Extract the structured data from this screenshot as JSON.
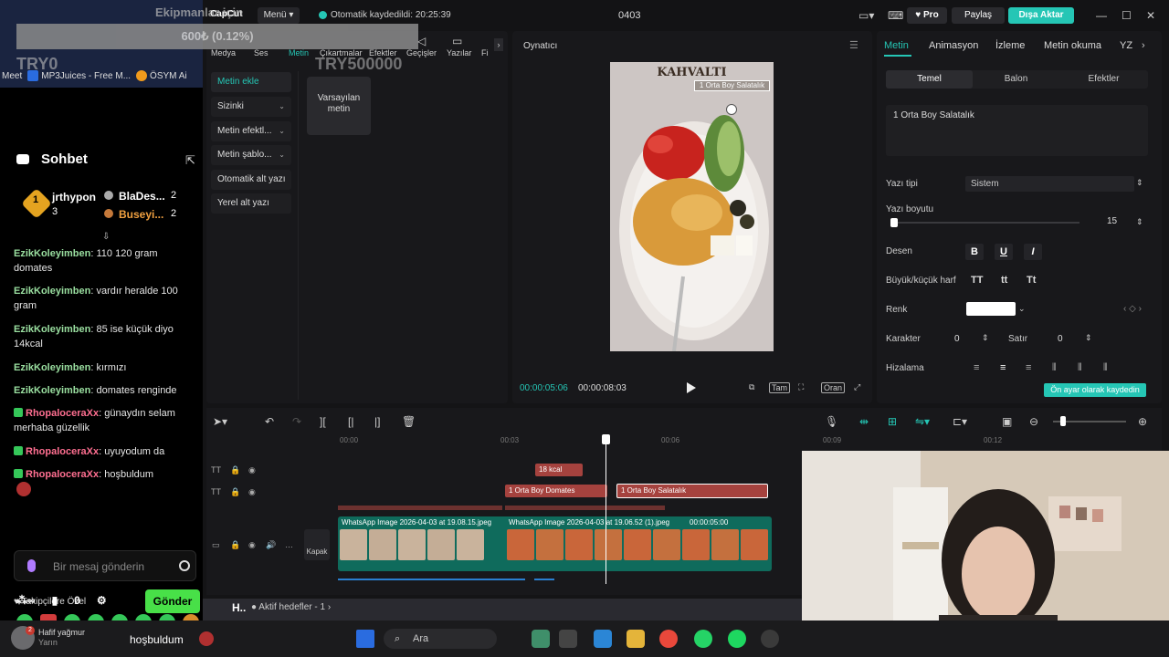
{
  "overlay": {
    "donation_title": "Ekipmanlar için",
    "donation_value": "600₺ (0.12%)",
    "goal_left": "TRY0",
    "goal_right": "TRY500000"
  },
  "bookmarks": [
    "Meet",
    "MP3Juices - Free M...",
    "ÖSYM Ai"
  ],
  "chat": {
    "title": "Sohbet",
    "leaderboard": {
      "top_user": "jrthypon",
      "top_count": "3",
      "second_user": "BlaDes...",
      "second_count": "2",
      "third_user": "Buseyi...",
      "third_count": "2"
    },
    "messages": [
      {
        "user": "EzikKoleyimben",
        "text": "110 120 gram domates"
      },
      {
        "user": "EzikKoleyimben",
        "text": "vardır heralde 100 gram"
      },
      {
        "user": "EzikKoleyimben",
        "text": "85 ise küçük diyo 14kcal"
      },
      {
        "user": "EzikKoleyimben",
        "text": "kırmızı"
      },
      {
        "user": "EzikKoleyimben",
        "text": "domates renginde"
      },
      {
        "user": "RhopaloceraXx",
        "text": "günaydın selam merhaba güzellik"
      },
      {
        "user": "RhopaloceraXx",
        "text": "uyuyodum da"
      },
      {
        "user": "RhopaloceraXx",
        "text": "hoşbuldum"
      }
    ],
    "followers_label": "Takipçilere Özel",
    "input_placeholder": "Bir mesaj gönderin",
    "send_label": "Gönder",
    "bottom_count": "0"
  },
  "capcut": {
    "logo": "CapCut",
    "menu_label": "Menü",
    "autosave": "Otomatik kaydedildi: 20:25:39",
    "project": "0403",
    "pro_label": "Pro",
    "share_label": "Paylaş",
    "export_label": "Dışa Aktar",
    "media_tabs": [
      "Medya",
      "Ses",
      "Metin",
      "Çıkartmalar",
      "Efektler",
      "Geçişler",
      "Yazılar",
      "Fi"
    ],
    "side_items": [
      "Metin ekle",
      "Sizinki",
      "Metin efektl...",
      "Metin şablo...",
      "Otomatik alt yazı",
      "Yerel alt yazı"
    ],
    "default_text": "Varsayılan metin",
    "player": {
      "title": "Oynatıcı",
      "video_title": "KAHVALTI",
      "selected_text": "1 Orta Boy Salatalık",
      "time_current": "00:00:05:06",
      "time_total": "00:00:08:03",
      "full_label": "Tam",
      "ratio_label": "Oran"
    },
    "props": {
      "tabs": [
        "Metin",
        "Animasyon",
        "İzleme",
        "Metin okuma",
        "YZ"
      ],
      "subtabs": [
        "Temel",
        "Balon",
        "Efektler"
      ],
      "text_value": "1 Orta Boy Salatalık",
      "font_label": "Yazı tipi",
      "font_value": "Sistem",
      "size_label": "Yazı boyutu",
      "size_value": "15",
      "pattern_label": "Desen",
      "case_label": "Büyük/küçük harf",
      "case_options": [
        "TT",
        "tt",
        "Tt"
      ],
      "color_label": "Renk",
      "char_label": "Karakter",
      "char_value": "0",
      "line_label": "Satır",
      "line_value": "0",
      "align_label": "Hizalama",
      "save_preset": "Ön ayar olarak kaydedin"
    },
    "timeline": {
      "ruler": [
        "00:00",
        "00:03",
        "00:06",
        "00:09",
        "00:12"
      ],
      "clips": [
        "18 kcal",
        "1 Orta Boy Domates",
        "1 Orta Boy Salatalık"
      ],
      "video_clip_1": "WhatsApp Image 2026-04-03 at 19.08.15.jpeg",
      "video_clip_2": "WhatsApp Image 2026-04-03 at 19.06.52 (1).jpeg",
      "video_clip_2_dur": "00:00:05:00",
      "cover_label": "Kapak"
    }
  },
  "taskbar": {
    "weather_line1": "Hafif yağmur",
    "weather_line2": "Yarın",
    "chat_text": "hoşbuldum",
    "search": "Ara",
    "goal_footer": "Aktif hedefler - 1"
  }
}
